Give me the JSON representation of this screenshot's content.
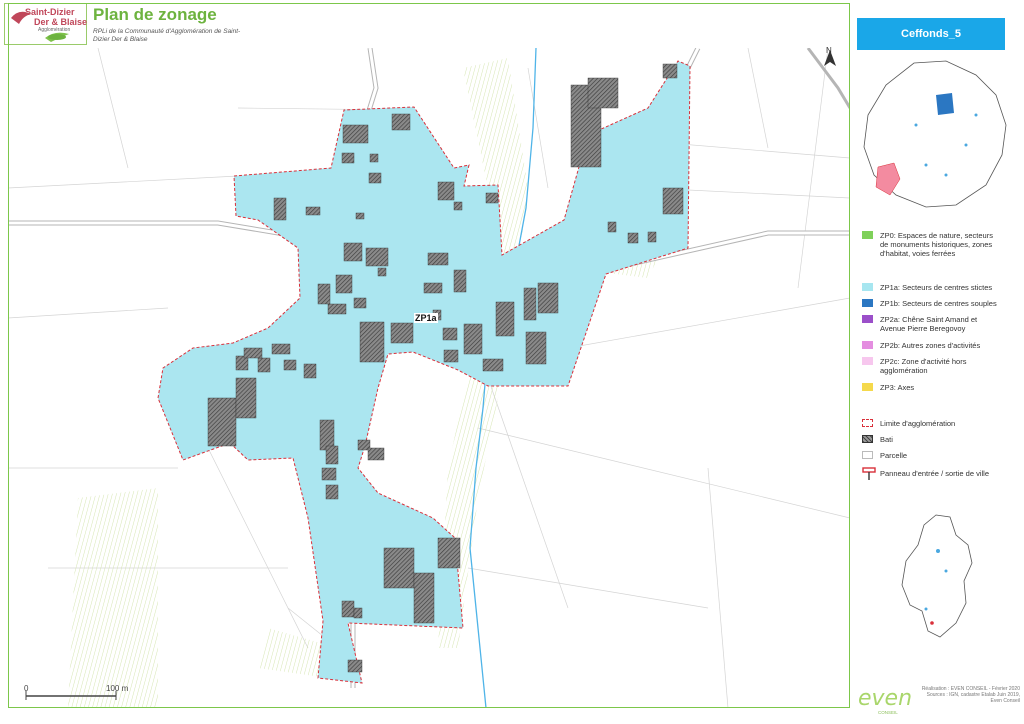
{
  "header": {
    "logo_line1": "Saint-Dizier",
    "logo_line2": "Der & Blaise",
    "logo_line3": "Agglomération",
    "title": "Plan de zonage",
    "subtitle": "RPLi de la Communauté d'Agglomération de Saint-Dizier Der & Blaise"
  },
  "map": {
    "zone_label": "ZP1a",
    "north_label": "N",
    "scale": {
      "start": "0",
      "end": "100 m"
    }
  },
  "sidebar": {
    "commune_name": "Ceffonds_5",
    "legend": [
      {
        "label": "ZP0: Espaces de nature, secteurs de monuments historiques, zones d'habitat, voies ferrées",
        "color": "#7fd15a"
      },
      {
        "label": "ZP1a: Secteurs de centres stictes",
        "color": "#a7e6f0"
      },
      {
        "label": "ZP1b: Secteurs de centres souples",
        "color": "#2b77c2"
      },
      {
        "label": "ZP2a: Chêne Saint Amand et Avenue Pierre Beregovoy",
        "color": "#9b4fc9"
      },
      {
        "label": "ZP2b: Autres zones d'activités",
        "color": "#e48ee0"
      },
      {
        "label": "ZP2c: Zone d'activité hors agglomération",
        "color": "#f7c7ee"
      },
      {
        "label": "ZP3: Axes",
        "color": "#f5d94c"
      },
      {
        "label": "Limite d'agglomération",
        "color": "#d9303a"
      },
      {
        "label": "Bati",
        "color": "#666666"
      },
      {
        "label": "Parcelle",
        "color": "#bbbbbb"
      },
      {
        "label": "Panneau d'entrée / sortie de ville",
        "color": "#d9303a"
      }
    ]
  },
  "footer": {
    "brand": "even",
    "brand_sub": "CONSEIL",
    "credits_1": "Réalisation : EVEN CONSEIL - Février 2020",
    "credits_2": "Sources : IGN, cadastre Etalab Juin 2019,",
    "credits_3": "Even Conseil"
  }
}
